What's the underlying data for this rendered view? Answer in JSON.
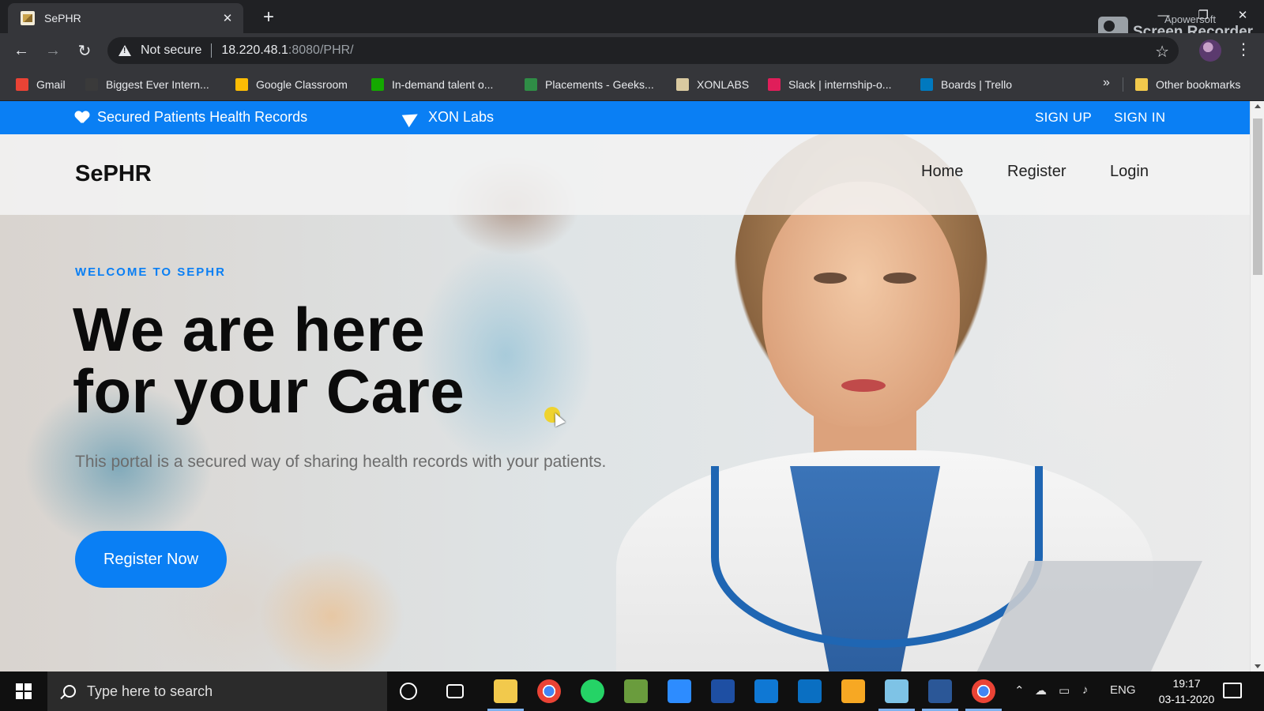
{
  "browser": {
    "tab": {
      "title": "SePHR",
      "close": "✕"
    },
    "new_tab": "+",
    "recorder": {
      "line1": "Apowersoft",
      "line2": "Screen Recorder"
    },
    "window_controls": {
      "minimize": "—",
      "restore": "❐",
      "close": "✕"
    },
    "nav": {
      "back": "←",
      "forward": "→",
      "reload": "↻"
    },
    "address": {
      "security": "Not secure",
      "host": "18.220.48.1",
      "path": ":8080/PHR/"
    },
    "star": "☆",
    "menu": "⋮",
    "bookmarks": [
      {
        "label": "Gmail",
        "icon": "gmail-icon",
        "color": "#ea4335"
      },
      {
        "label": "Biggest Ever Intern...",
        "icon": "internshala-icon",
        "color": "#3a3a3a"
      },
      {
        "label": "Google Classroom",
        "icon": "classroom-icon",
        "color": "#fbbc04"
      },
      {
        "label": "In-demand talent o...",
        "icon": "upwork-icon",
        "color": "#14a800"
      },
      {
        "label": "Placements - Geeks...",
        "icon": "geeksforgeeks-icon",
        "color": "#2f8d46"
      },
      {
        "label": "XONLABS",
        "icon": "xonlabs-icon",
        "color": "#d9c9a0"
      },
      {
        "label": "Slack | internship-o...",
        "icon": "slack-icon",
        "color": "#e01e5a"
      },
      {
        "label": "Boards | Trello",
        "icon": "trello-icon",
        "color": "#0079bf"
      }
    ],
    "bookmarks_more": "»",
    "other_bookmarks": "Other bookmarks"
  },
  "site": {
    "topbar": {
      "tagline": "Secured Patients Health Records",
      "company": "XON Labs",
      "signup": "SIGN UP",
      "signin": "SIGN IN"
    },
    "logo": "SePHR",
    "nav": [
      "Home",
      "Register",
      "Login"
    ],
    "hero": {
      "eyebrow": "WELCOME TO SEPHR",
      "headline_1": "We are here",
      "headline_2": "for your Care",
      "description": "This portal is a secured way of sharing health records with your patients.",
      "cta": "Register Now"
    },
    "colors": {
      "accent": "#0a7ff4",
      "heading": "#0b0b0b"
    }
  },
  "taskbar": {
    "search_placeholder": "Type here to search",
    "apps": [
      {
        "icon": "cortana-icon"
      },
      {
        "icon": "task-view-icon"
      },
      {
        "icon": "file-explorer-icon"
      },
      {
        "icon": "chrome-icon"
      },
      {
        "icon": "whatsapp-icon"
      },
      {
        "icon": "app-icon"
      },
      {
        "icon": "zoom-icon"
      },
      {
        "icon": "dev-icon"
      },
      {
        "icon": "outlook-icon"
      },
      {
        "icon": "vscode-icon"
      },
      {
        "icon": "media-player-icon"
      },
      {
        "icon": "app-icon"
      },
      {
        "icon": "app-icon"
      },
      {
        "icon": "chrome-icon"
      }
    ],
    "language": "ENG",
    "time": "19:17",
    "date": "03-11-2020"
  }
}
